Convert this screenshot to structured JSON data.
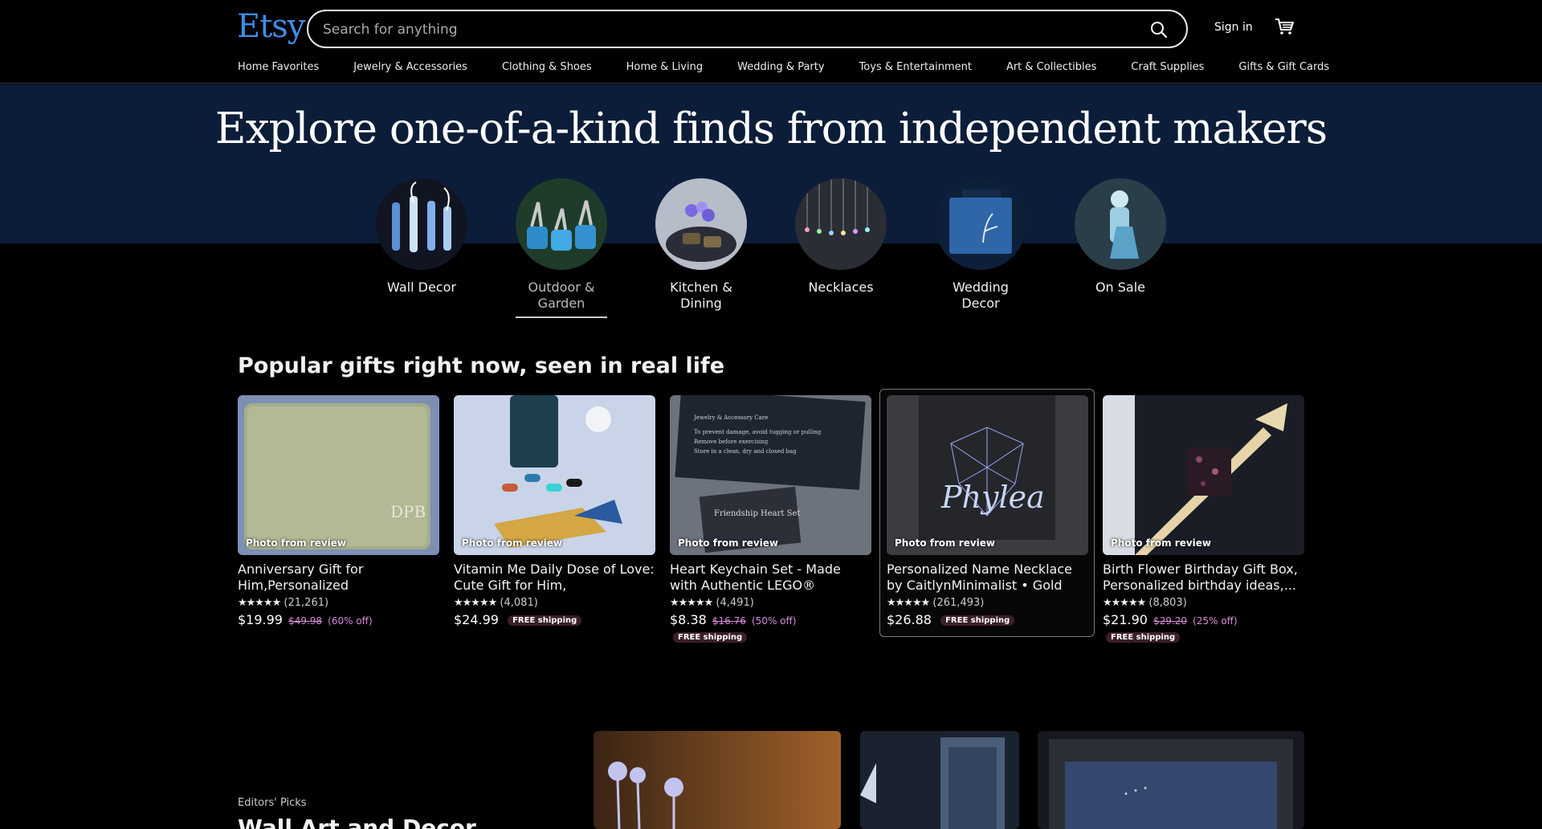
{
  "header": {
    "logo": "Etsy",
    "search_placeholder": "Search for anything",
    "search_icon": "search-icon",
    "signin_label": "Sign in",
    "cart_icon": "cart-icon"
  },
  "nav": [
    "Home Favorites",
    "Jewelry & Accessories",
    "Clothing & Shoes",
    "Home & Living",
    "Wedding & Party",
    "Toys & Entertainment",
    "Art & Collectibles",
    "Craft Supplies",
    "Gifts & Gift Cards"
  ],
  "hero": {
    "title": "Explore one-of-a-kind finds from independent makers",
    "categories": [
      {
        "label": "Wall Decor",
        "active": false
      },
      {
        "label": "Outdoor & Garden",
        "active": true
      },
      {
        "label": "Kitchen & Dining",
        "active": false
      },
      {
        "label": "Necklaces",
        "active": false
      },
      {
        "label": "Wedding Decor",
        "active": false
      },
      {
        "label": "On Sale",
        "active": false
      }
    ]
  },
  "popular": {
    "title": "Popular gifts right now, seen in real life",
    "badge": "Photo from review",
    "items": [
      {
        "title": "Anniversary Gift for Him,Personalized Wallet,Mens...",
        "reviews": "(21,261)",
        "price": "$19.99",
        "original": "$49.98",
        "discount": "(60% off)",
        "shipping": ""
      },
      {
        "title": "Vitamin Me Daily Dose of Love: Cute Gift for Him, Anniversary...",
        "reviews": "(4,081)",
        "price": "$24.99",
        "original": "",
        "discount": "",
        "shipping": "FREE shipping"
      },
      {
        "title": "Heart Keychain Set - Made with Authentic LEGO® Bricks,...",
        "reviews": "(4,491)",
        "price": "$8.38",
        "original": "$16.76",
        "discount": "(50% off)",
        "shipping": "FREE shipping"
      },
      {
        "title": "Personalized Name Necklace by CaitlynMinimalist • Gold Name...",
        "reviews": "(261,493)",
        "price": "$26.88",
        "original": "",
        "discount": "",
        "shipping": "FREE shipping"
      },
      {
        "title": "Birth Flower Birthday Gift Box, Personalized birthday ideas,...",
        "reviews": "(8,803)",
        "price": "$21.90",
        "original": "$29.20",
        "discount": "(25% off)",
        "shipping": "FREE shipping"
      }
    ],
    "stars": "★★★★★"
  },
  "editors": {
    "label": "Editors' Picks",
    "title": "Wall Art and Decor"
  }
}
